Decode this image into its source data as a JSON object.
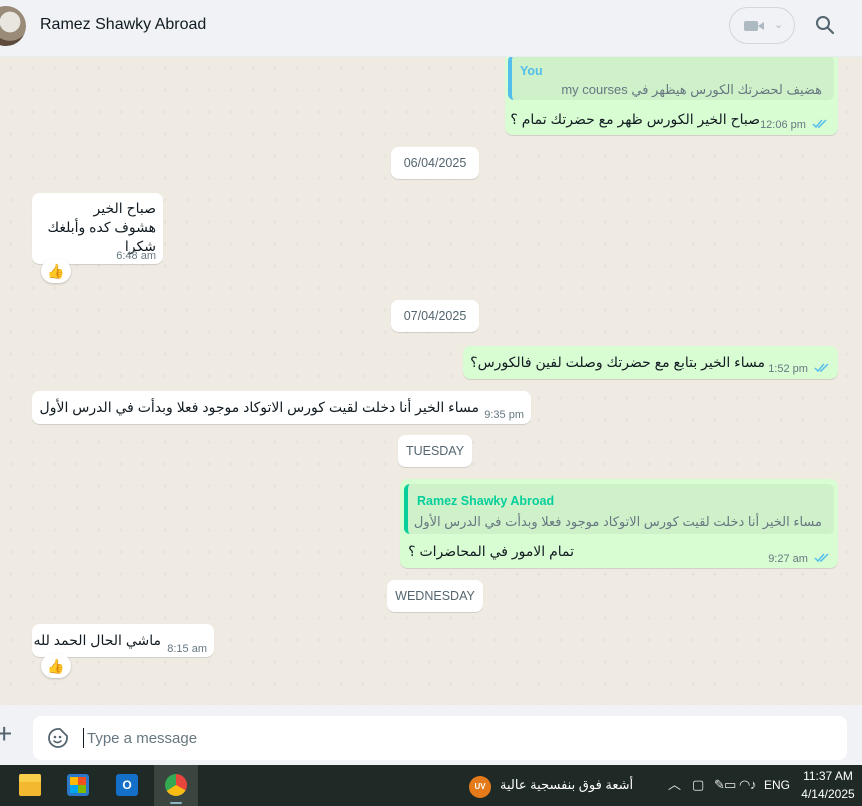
{
  "header": {
    "contact_name": "Ramez Shawky Abroad",
    "avatar_icon": "avatar-photo",
    "video_icon": "video-camera-icon",
    "chevron_icon": "chevron-down-icon",
    "search_icon": "search-icon"
  },
  "messages": [
    {
      "id": "m1",
      "direction": "outgoing",
      "quote_author": "You",
      "quote_text": "هضيف لحضرتك الكورس هيظهر في my courses",
      "text": "صباح الخير الكورس ظهر مع حضرتك تمام ؟",
      "time": "12:06 pm",
      "status": "read"
    },
    {
      "id": "d1",
      "type": "date",
      "label": "06/04/2025"
    },
    {
      "id": "m2",
      "direction": "incoming",
      "lines": [
        "صباح الخير",
        "هشوف كده وأبلغك",
        "شكرا"
      ],
      "time": "6:48 am",
      "reaction": "👍"
    },
    {
      "id": "d2",
      "type": "date",
      "label": "07/04/2025"
    },
    {
      "id": "m3",
      "direction": "outgoing",
      "text": "مساء الخير بتابع مع حضرتك وصلت لفين فالكورس؟",
      "time": "1:52 pm",
      "status": "read"
    },
    {
      "id": "m4",
      "direction": "incoming",
      "text": "مساء الخير أنا دخلت لقيت كورس الاتوكاد موجود فعلا وبدأت في الدرس الأول",
      "time": "9:35 pm"
    },
    {
      "id": "d3",
      "type": "date",
      "label": "TUESDAY"
    },
    {
      "id": "m5",
      "direction": "outgoing",
      "quote_author": "Ramez Shawky Abroad",
      "quote_text": "مساء الخير أنا دخلت لقيت كورس الاتوكاد موجود فعلا وبدأت في الدرس الأول",
      "text": "تمام الامور في المحاضرات ؟",
      "time": "9:27 am",
      "status": "read"
    },
    {
      "id": "d4",
      "type": "date",
      "label": "WEDNESDAY"
    },
    {
      "id": "m6",
      "direction": "incoming",
      "text": "ماشي الحال الحمد لله",
      "time": "8:15 am",
      "reaction": "👍"
    }
  ],
  "composer": {
    "plus_icon": "plus-icon",
    "sticker_icon": "sticker-icon",
    "placeholder": "Type a message",
    "value": ""
  },
  "taskbar": {
    "apps": [
      {
        "name": "file-explorer-icon",
        "color": "#f2b830"
      },
      {
        "name": "microsoft-store-icon",
        "color": "#3a86d6"
      },
      {
        "name": "outlook-icon",
        "color": "#1570c9"
      },
      {
        "name": "chrome-icon",
        "color": "#e8453c",
        "active": true
      }
    ],
    "uv_badge": "UV",
    "weather_text": "أشعة فوق بنفسجية عالية",
    "tray_icons": [
      "chevron-up-icon",
      "meet-now-icon",
      "pen-icon",
      "display-icon",
      "wifi-icon",
      "volume-icon",
      "battery-icon"
    ],
    "language": "ENG",
    "time": "11:37 AM",
    "date": "4/14/2025"
  },
  "colors": {
    "outgoing_bubble": "#d9fdd3",
    "incoming_bubble": "#ffffff",
    "chat_background": "#efeae2",
    "read_ticks": "#53bdeb",
    "quote_you": "#06cf9c",
    "quote_contact": "#06cf9c",
    "taskbar": "#1f2a26"
  }
}
